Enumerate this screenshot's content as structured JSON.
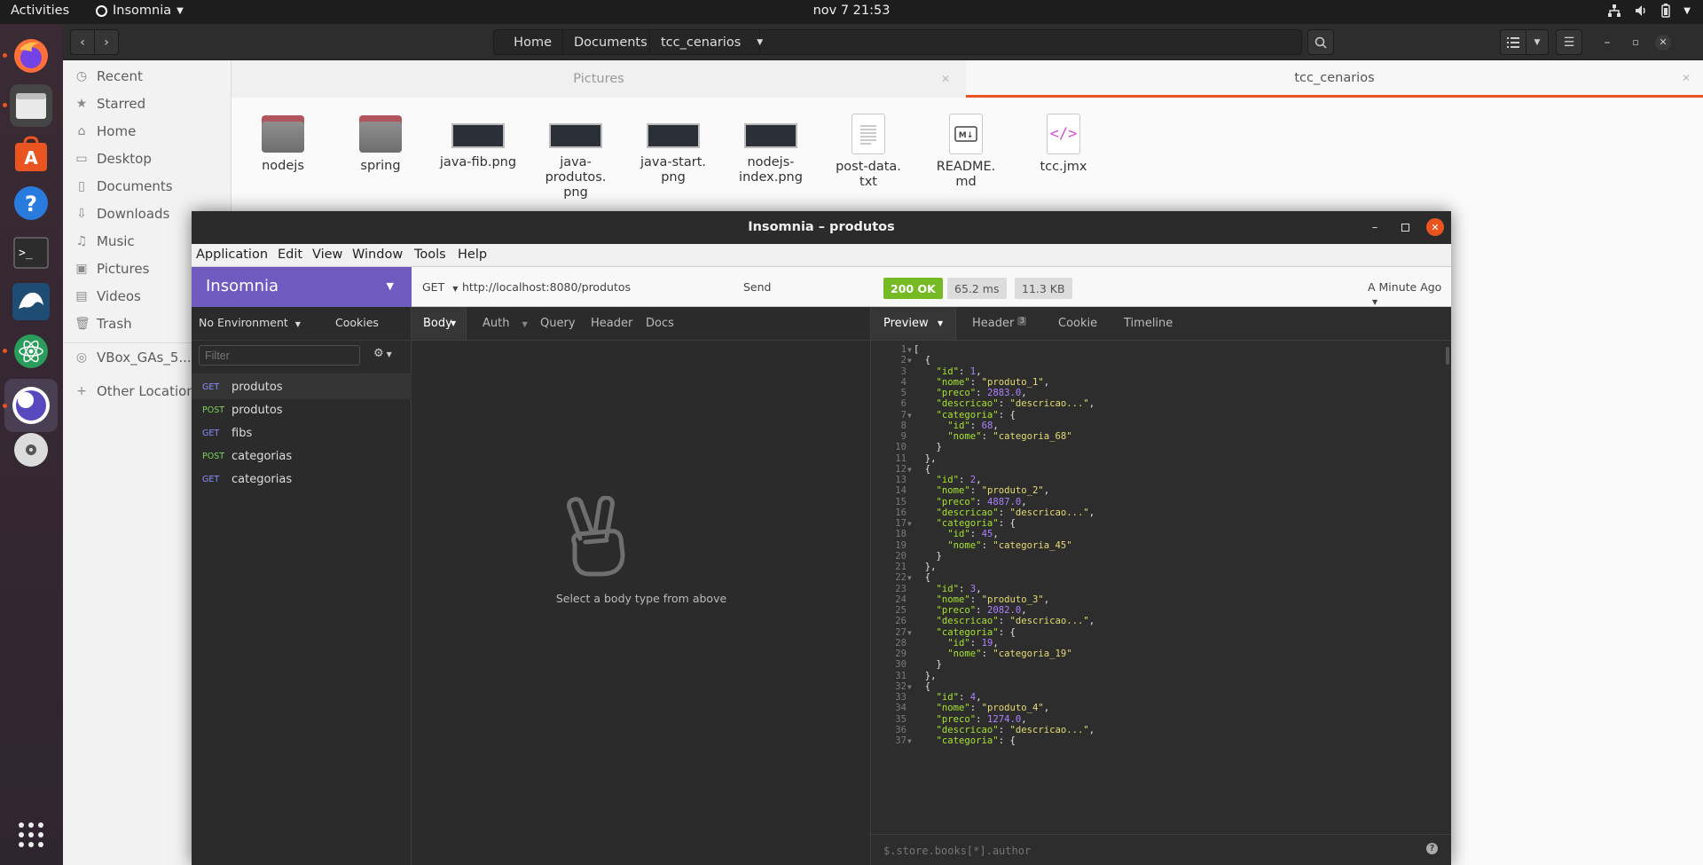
{
  "topbar": {
    "activities": "Activities",
    "app_name": "Insomnia",
    "clock": "nov 7  21:53"
  },
  "dock": {
    "items": [
      "firefox-icon",
      "files-icon",
      "software-icon",
      "help-icon",
      "terminal-icon",
      "mysql-workbench-icon",
      "atom-icon",
      "insomnia-icon",
      "disc-icon",
      "app-grid-icon"
    ]
  },
  "nautilus": {
    "breadcrumbs": [
      "Home",
      "Documents",
      "tcc_cenarios"
    ],
    "tabs": [
      {
        "label": "Pictures",
        "active": false
      },
      {
        "label": "tcc_cenarios",
        "active": true
      }
    ],
    "sidebar": [
      {
        "icon": "clock-icon",
        "label": "Recent"
      },
      {
        "icon": "star-icon",
        "label": "Starred"
      },
      {
        "icon": "home-icon",
        "label": "Home"
      },
      {
        "icon": "desktop-icon",
        "label": "Desktop"
      },
      {
        "icon": "documents-icon",
        "label": "Documents"
      },
      {
        "icon": "downloads-icon",
        "label": "Downloads"
      },
      {
        "icon": "music-icon",
        "label": "Music"
      },
      {
        "icon": "pictures-icon",
        "label": "Pictures"
      },
      {
        "icon": "videos-icon",
        "label": "Videos"
      },
      {
        "icon": "trash-icon",
        "label": "Trash"
      },
      {
        "icon": "drive-icon",
        "label": "VBox_GAs_5...."
      },
      {
        "icon": "plus-icon",
        "label": "Other Locations"
      }
    ],
    "files": [
      {
        "type": "folder",
        "name": "nodejs"
      },
      {
        "type": "folder",
        "name": "spring"
      },
      {
        "type": "png",
        "name": "java-fib.png"
      },
      {
        "type": "png",
        "name": "java-\nprodutos.\npng"
      },
      {
        "type": "png",
        "name": "java-start.\npng"
      },
      {
        "type": "png",
        "name": "nodejs-\nindex.png"
      },
      {
        "type": "text",
        "name": "post-data.\ntxt"
      },
      {
        "type": "markdown",
        "name": "README.\nmd"
      },
      {
        "type": "xml",
        "name": "tcc.jmx"
      }
    ]
  },
  "insomnia": {
    "title": "Insomnia – produtos",
    "menu": [
      "Application",
      "Edit",
      "View",
      "Window",
      "Tools",
      "Help"
    ],
    "workspace": "Insomnia",
    "environment": "No Environment",
    "cookies": "Cookies",
    "filter_placeholder": "Filter",
    "requests": [
      {
        "method": "GET",
        "name": "produtos",
        "active": true
      },
      {
        "method": "POST",
        "name": "produtos",
        "active": false
      },
      {
        "method": "GET",
        "name": "fibs",
        "active": false
      },
      {
        "method": "POST",
        "name": "categorias",
        "active": false
      },
      {
        "method": "GET",
        "name": "categorias",
        "active": false
      }
    ],
    "method_colors": {
      "GET": "#8d8dff",
      "POST": "#7fd25b"
    },
    "request": {
      "method": "GET",
      "url": "http://localhost:8080/produtos",
      "send": "Send",
      "tabs": [
        "Body",
        "Auth",
        "Query",
        "Header",
        "Docs"
      ],
      "empty_body": "Select a body type from above"
    },
    "response": {
      "status": "200 OK",
      "status_color": "#75ba24",
      "time": "65.2 ms",
      "size": "11.3 KB",
      "history": "A Minute Ago",
      "tabs": [
        "Preview",
        "Header",
        "Cookie",
        "Timeline"
      ],
      "header_count": "3",
      "filter_placeholder": "$.store.books[*].author",
      "help": "?",
      "lines": [
        [
          [
            "p",
            "["
          ]
        ],
        [
          [
            "p",
            "  {"
          ]
        ],
        [
          [
            "p",
            "    "
          ],
          [
            "k",
            "\"id\""
          ],
          [
            "p",
            ": "
          ],
          [
            "n",
            "1"
          ],
          [
            "p",
            ","
          ]
        ],
        [
          [
            "p",
            "    "
          ],
          [
            "k",
            "\"nome\""
          ],
          [
            "p",
            ": "
          ],
          [
            "s",
            "\"produto_1\""
          ],
          [
            "p",
            ","
          ]
        ],
        [
          [
            "p",
            "    "
          ],
          [
            "k",
            "\"preco\""
          ],
          [
            "p",
            ": "
          ],
          [
            "n",
            "2883.0"
          ],
          [
            "p",
            ","
          ]
        ],
        [
          [
            "p",
            "    "
          ],
          [
            "k",
            "\"descricao\""
          ],
          [
            "p",
            ": "
          ],
          [
            "s",
            "\"descricao...\""
          ],
          [
            "p",
            ","
          ]
        ],
        [
          [
            "p",
            "    "
          ],
          [
            "k",
            "\"categoria\""
          ],
          [
            "p",
            ": {"
          ]
        ],
        [
          [
            "p",
            "      "
          ],
          [
            "k",
            "\"id\""
          ],
          [
            "p",
            ": "
          ],
          [
            "n",
            "68"
          ],
          [
            "p",
            ","
          ]
        ],
        [
          [
            "p",
            "      "
          ],
          [
            "k",
            "\"nome\""
          ],
          [
            "p",
            ": "
          ],
          [
            "s",
            "\"categoria_68\""
          ]
        ],
        [
          [
            "p",
            "    }"
          ]
        ],
        [
          [
            "p",
            "  },"
          ]
        ],
        [
          [
            "p",
            "  {"
          ]
        ],
        [
          [
            "p",
            "    "
          ],
          [
            "k",
            "\"id\""
          ],
          [
            "p",
            ": "
          ],
          [
            "n",
            "2"
          ],
          [
            "p",
            ","
          ]
        ],
        [
          [
            "p",
            "    "
          ],
          [
            "k",
            "\"nome\""
          ],
          [
            "p",
            ": "
          ],
          [
            "s",
            "\"produto_2\""
          ],
          [
            "p",
            ","
          ]
        ],
        [
          [
            "p",
            "    "
          ],
          [
            "k",
            "\"preco\""
          ],
          [
            "p",
            ": "
          ],
          [
            "n",
            "4887.0"
          ],
          [
            "p",
            ","
          ]
        ],
        [
          [
            "p",
            "    "
          ],
          [
            "k",
            "\"descricao\""
          ],
          [
            "p",
            ": "
          ],
          [
            "s",
            "\"descricao...\""
          ],
          [
            "p",
            ","
          ]
        ],
        [
          [
            "p",
            "    "
          ],
          [
            "k",
            "\"categoria\""
          ],
          [
            "p",
            ": {"
          ]
        ],
        [
          [
            "p",
            "      "
          ],
          [
            "k",
            "\"id\""
          ],
          [
            "p",
            ": "
          ],
          [
            "n",
            "45"
          ],
          [
            "p",
            ","
          ]
        ],
        [
          [
            "p",
            "      "
          ],
          [
            "k",
            "\"nome\""
          ],
          [
            "p",
            ": "
          ],
          [
            "s",
            "\"categoria_45\""
          ]
        ],
        [
          [
            "p",
            "    }"
          ]
        ],
        [
          [
            "p",
            "  },"
          ]
        ],
        [
          [
            "p",
            "  {"
          ]
        ],
        [
          [
            "p",
            "    "
          ],
          [
            "k",
            "\"id\""
          ],
          [
            "p",
            ": "
          ],
          [
            "n",
            "3"
          ],
          [
            "p",
            ","
          ]
        ],
        [
          [
            "p",
            "    "
          ],
          [
            "k",
            "\"nome\""
          ],
          [
            "p",
            ": "
          ],
          [
            "s",
            "\"produto_3\""
          ],
          [
            "p",
            ","
          ]
        ],
        [
          [
            "p",
            "    "
          ],
          [
            "k",
            "\"preco\""
          ],
          [
            "p",
            ": "
          ],
          [
            "n",
            "2082.0"
          ],
          [
            "p",
            ","
          ]
        ],
        [
          [
            "p",
            "    "
          ],
          [
            "k",
            "\"descricao\""
          ],
          [
            "p",
            ": "
          ],
          [
            "s",
            "\"descricao...\""
          ],
          [
            "p",
            ","
          ]
        ],
        [
          [
            "p",
            "    "
          ],
          [
            "k",
            "\"categoria\""
          ],
          [
            "p",
            ": {"
          ]
        ],
        [
          [
            "p",
            "      "
          ],
          [
            "k",
            "\"id\""
          ],
          [
            "p",
            ": "
          ],
          [
            "n",
            "19"
          ],
          [
            "p",
            ","
          ]
        ],
        [
          [
            "p",
            "      "
          ],
          [
            "k",
            "\"nome\""
          ],
          [
            "p",
            ": "
          ],
          [
            "s",
            "\"categoria_19\""
          ]
        ],
        [
          [
            "p",
            "    }"
          ]
        ],
        [
          [
            "p",
            "  },"
          ]
        ],
        [
          [
            "p",
            "  {"
          ]
        ],
        [
          [
            "p",
            "    "
          ],
          [
            "k",
            "\"id\""
          ],
          [
            "p",
            ": "
          ],
          [
            "n",
            "4"
          ],
          [
            "p",
            ","
          ]
        ],
        [
          [
            "p",
            "    "
          ],
          [
            "k",
            "\"nome\""
          ],
          [
            "p",
            ": "
          ],
          [
            "s",
            "\"produto_4\""
          ],
          [
            "p",
            ","
          ]
        ],
        [
          [
            "p",
            "    "
          ],
          [
            "k",
            "\"preco\""
          ],
          [
            "p",
            ": "
          ],
          [
            "n",
            "1274.0"
          ],
          [
            "p",
            ","
          ]
        ],
        [
          [
            "p",
            "    "
          ],
          [
            "k",
            "\"descricao\""
          ],
          [
            "p",
            ": "
          ],
          [
            "s",
            "\"descricao...\""
          ],
          [
            "p",
            ","
          ]
        ],
        [
          [
            "p",
            "    "
          ],
          [
            "k",
            "\"categoria\""
          ],
          [
            "p",
            ": {"
          ]
        ]
      ],
      "fold_lines": [
        1,
        2,
        7,
        12,
        17,
        22,
        27,
        32,
        37
      ]
    }
  }
}
